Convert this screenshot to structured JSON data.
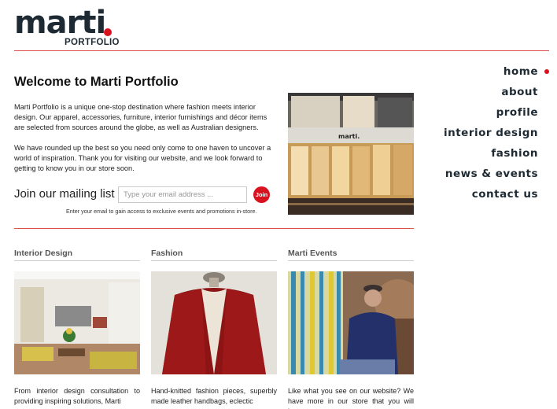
{
  "logo": {
    "word": "marti",
    "sub": "PORTFOLIO"
  },
  "nav": {
    "items": [
      {
        "label": "home",
        "active": true
      },
      {
        "label": "about",
        "active": false
      },
      {
        "label": "profile",
        "active": false
      },
      {
        "label": "interior design",
        "active": false
      },
      {
        "label": "fashion",
        "active": false
      },
      {
        "label": "news & events",
        "active": false
      },
      {
        "label": "contact us",
        "active": false
      }
    ]
  },
  "welcome": {
    "title": "Welcome to Marti Portfolio",
    "para1": "Marti Portfolio is a unique one-stop destination where fashion meets interior design. Our apparel, accessories, furniture, interior furnishings and décor items are selected from sources around the globe, as well as Australian designers.",
    "para2": "We have rounded up the best so you need only come to one haven to uncover a world of inspiration. Thank you for visiting our website, and we look forward to getting to know you in our store soon."
  },
  "mailing": {
    "label": "Join our mailing list",
    "placeholder": "Type your email address ...",
    "button": "Join",
    "note": "Enter your email to gain access to exclusive events and promotions in-store."
  },
  "columns": [
    {
      "title": "Interior Design",
      "text": "From interior design consultation to providing inspiring solutions, Marti"
    },
    {
      "title": "Fashion",
      "text": "Hand-knitted fashion pieces, superbly made leather handbags, eclectic"
    },
    {
      "title": "Marti Events",
      "text": "Like what you see on our website? We have more in our store that you will love."
    }
  ],
  "colors": {
    "accent": "#d9121f",
    "brand": "#1e2a33",
    "rule": "#e05050"
  }
}
